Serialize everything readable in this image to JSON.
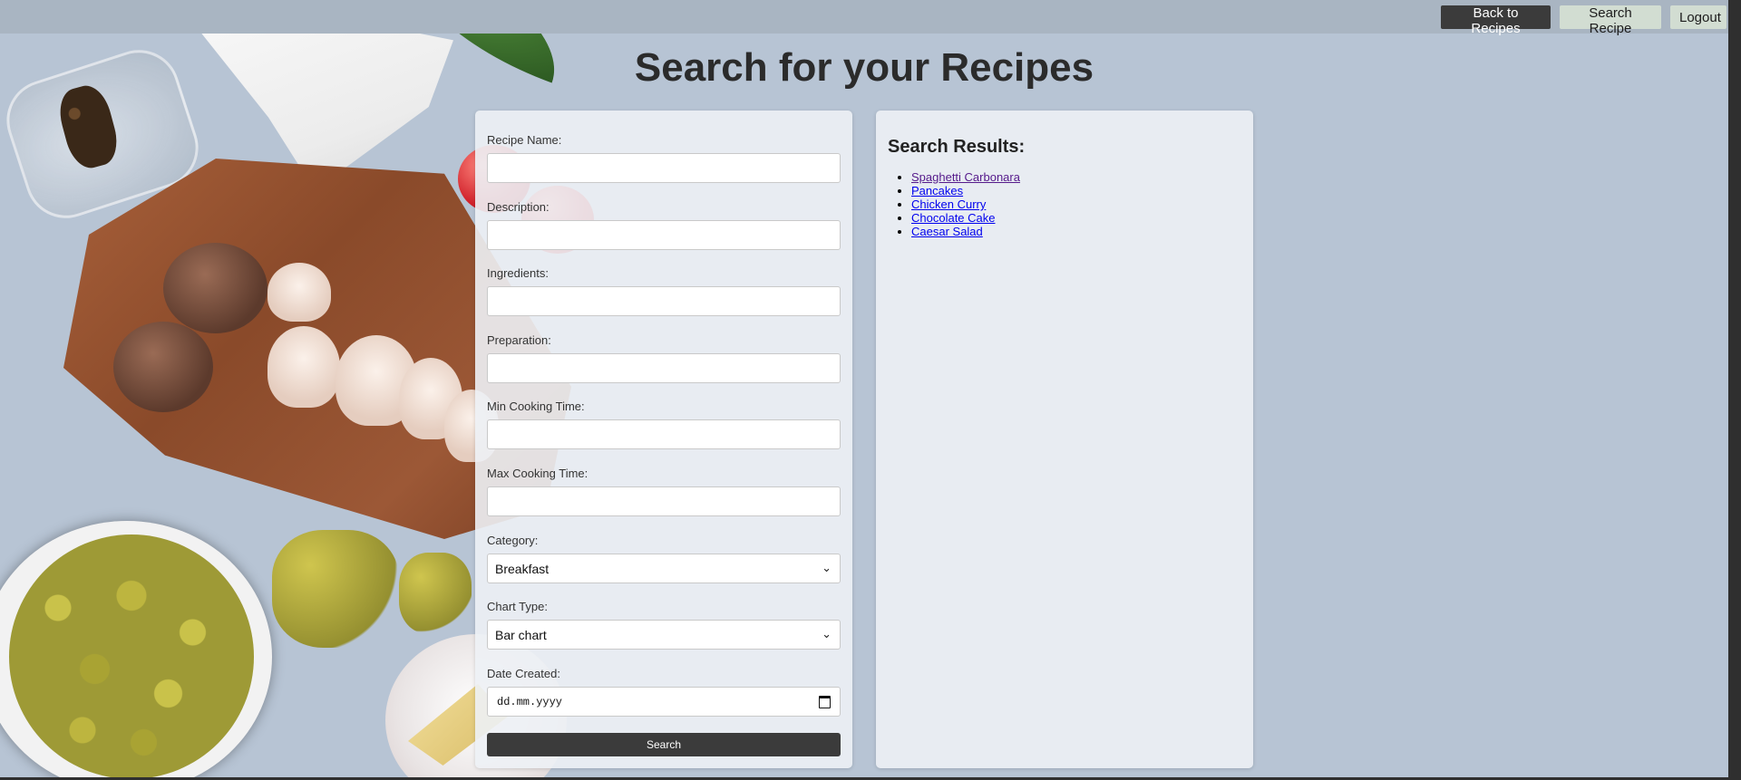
{
  "nav": {
    "back_label": "Back to Recipes",
    "search_label": "Search Recipe",
    "logout_label": "Logout"
  },
  "page": {
    "title": "Search for your Recipes"
  },
  "form": {
    "recipe_name": {
      "label": "Recipe Name:",
      "value": ""
    },
    "description": {
      "label": "Description:",
      "value": ""
    },
    "ingredients": {
      "label": "Ingredients:",
      "value": ""
    },
    "preparation": {
      "label": "Preparation:",
      "value": ""
    },
    "min_cooking_time": {
      "label": "Min Cooking Time:",
      "value": ""
    },
    "max_cooking_time": {
      "label": "Max Cooking Time:",
      "value": ""
    },
    "category": {
      "label": "Category:",
      "selected": "Breakfast"
    },
    "chart_type": {
      "label": "Chart Type:",
      "selected": "Bar chart"
    },
    "date_created": {
      "label": "Date Created:",
      "placeholder": "dd.mm.yyyy"
    },
    "search_label": "Search"
  },
  "results": {
    "title": "Search Results:",
    "items": [
      "Spaghetti Carbonara",
      "Pancakes",
      "Chicken Curry",
      "Chocolate Cake",
      "Caesar Salad"
    ]
  },
  "colors": {
    "background": "#b7c4d4",
    "dark_button": "#3b3b3b",
    "light_button": "#d2ddd2",
    "link": "#0000ee",
    "visited_link": "#551a8b"
  }
}
